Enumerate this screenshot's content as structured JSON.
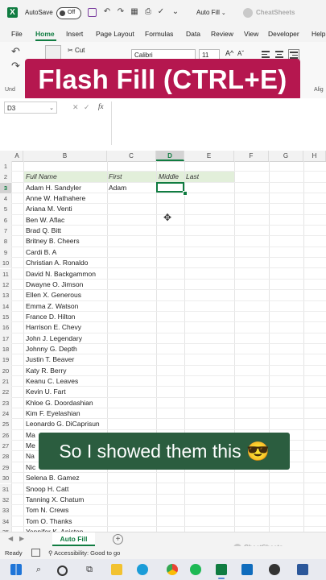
{
  "titlebar": {
    "app_logo": "X",
    "autosave_label": "AutoSave",
    "autosave_state": "Off",
    "filename": "Auto Fill",
    "brand": "CheatSheets"
  },
  "menu": {
    "items": [
      "File",
      "Home",
      "Insert",
      "Page Layout",
      "Formulas",
      "Data",
      "Review",
      "View",
      "Developer",
      "Help"
    ],
    "active": "Home"
  },
  "ribbon": {
    "cut_label": "Cut",
    "font_name": "Calibri",
    "font_size": "11",
    "grow_font": "A^",
    "shrink_font": "Aˇ",
    "undo_group": "Und",
    "alignment_group": "Alig"
  },
  "banner": {
    "text": "Flash Fill (CTRL+E)"
  },
  "formula_bar": {
    "name_box": "D3",
    "fx_label": "fx",
    "cancel_glyph": "✕",
    "enter_glyph": "✓",
    "formula": ""
  },
  "grid": {
    "columns": [
      "A",
      "B",
      "C",
      "D",
      "E",
      "F",
      "G",
      "H"
    ],
    "selected_column": "D",
    "row_numbers": [
      "1",
      "2",
      "3",
      "4",
      "5",
      "6",
      "7",
      "8",
      "9",
      "10",
      "11",
      "12",
      "13",
      "14",
      "15",
      "16",
      "17",
      "18",
      "19",
      "20",
      "21",
      "22",
      "23",
      "24",
      "25",
      "26",
      "27",
      "28",
      "29",
      "30",
      "31",
      "32",
      "33",
      "34",
      "35"
    ],
    "headers": {
      "full_name": "Full Name",
      "first": "First",
      "middle": "Middle",
      "last": "Last"
    },
    "names": [
      "Adam H. Sandyler",
      "Anne W. Hathahere",
      "Ariana M. Venti",
      "Ben W. Aflac",
      "Brad Q. Bitt",
      "Britney B. Cheers",
      "Cardi B. A",
      "Christian A. Ronaldo",
      "David N. Backgammon",
      "Dwayne O. Jimson",
      "Ellen X. Generous",
      "Emma Z. Watson",
      "France D. Hilton",
      "Harrison E. Chevy",
      "John J. Legendary",
      "Johnny G. Depth",
      "Justin T. Beaver",
      "Katy R. Berry",
      "Keanu C. Leaves",
      "Kevin U. Fart",
      "Khloe G. Doordashian",
      "Kim F. Eyelashian",
      "Leonardo G. DiCaprisun",
      "Ma",
      "Me",
      "Na",
      "Nic",
      "Selena B. Gamez",
      "Snoop H. Catt",
      "Tanning X. Chatum",
      "Tom N. Crews",
      "Tom O. Thanks",
      "Yennifer K. Aniston"
    ],
    "first_values": [
      "Adam"
    ]
  },
  "caption": {
    "text": "So I showed them this 😎"
  },
  "sheets": {
    "active_tab": "Auto Fill",
    "add_glyph": "+"
  },
  "statusbar": {
    "ready": "Ready",
    "accessibility": "Accessibility: Good to go"
  },
  "colors": {
    "excel_green": "#107c41",
    "banner": "#b5174f",
    "caption_bg": "#2b5d3f",
    "header_band": "#e2efda"
  },
  "taskbar_icons": [
    "windows-icon",
    "search-icon",
    "task-view-icon",
    "widgets-icon",
    "file-explorer-icon",
    "edge-icon",
    "chrome-icon",
    "spotify-icon",
    "mail-icon",
    "excel-icon",
    "outlook-icon",
    "obs-icon",
    "settings-icon",
    "edge-dev-icon"
  ]
}
